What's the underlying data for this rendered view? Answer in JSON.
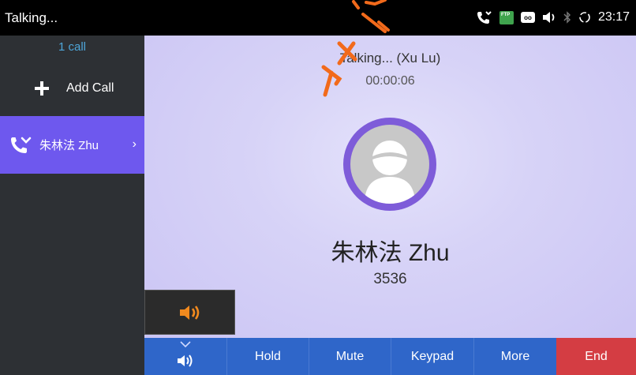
{
  "status_bar": {
    "title": "Talking...",
    "ftp_label": "FTP",
    "time": "23:17"
  },
  "sidebar": {
    "call_count": "1 call",
    "add_call_label": "Add Call",
    "active_call": {
      "name": "朱林法 Zhu"
    }
  },
  "main": {
    "header_status": "Talking... (Xu Lu)",
    "timer": "00:00:06",
    "contact_name": "朱林法 Zhu",
    "contact_number": "3536"
  },
  "bottom_bar": {
    "hold_label": "Hold",
    "mute_label": "Mute",
    "keypad_label": "Keypad",
    "more_label": "More",
    "end_label": "End"
  },
  "colors": {
    "accent": "#6e58ee",
    "button_blue": "#2f66c9",
    "end_red": "#d43d43",
    "speaker_orange": "#f28a1e"
  }
}
